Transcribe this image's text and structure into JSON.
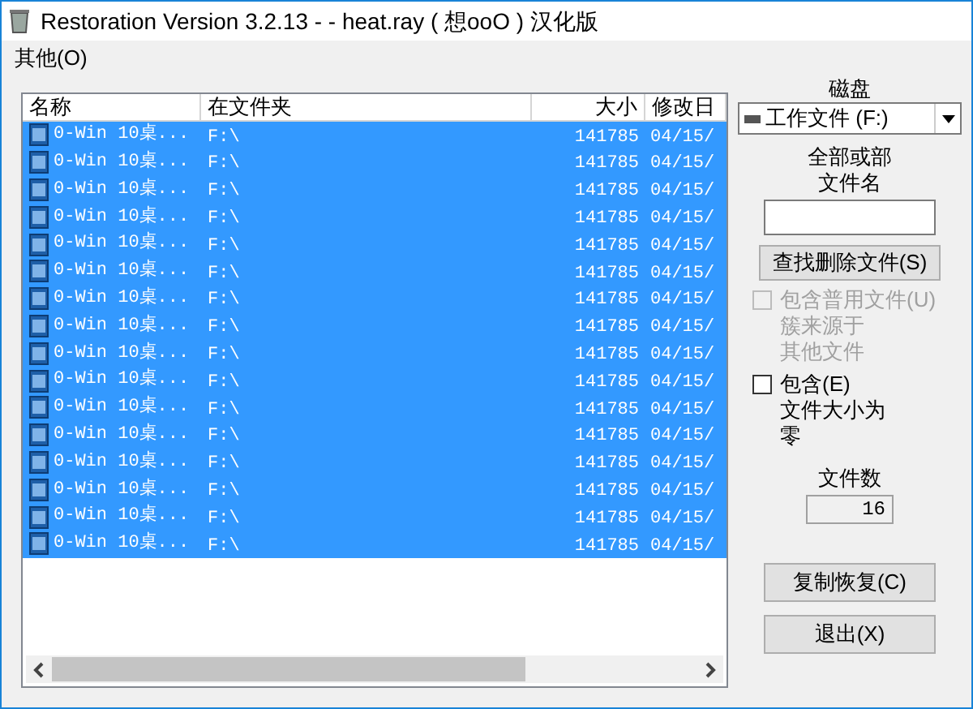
{
  "window": {
    "title": "Restoration Version 3.2.13   - - heat.ray ( 想ooO ) 汉化版"
  },
  "menu": [
    "其他(O)"
  ],
  "table": {
    "columns": [
      "名称",
      "在文件夹",
      "大小",
      "修改日"
    ],
    "rows": [
      {
        "name": "0-Win 10桌...",
        "folder": "F:\\",
        "size": "141785",
        "date": "04/15/",
        "selected": true
      },
      {
        "name": "0-Win 10桌...",
        "folder": "F:\\",
        "size": "141785",
        "date": "04/15/",
        "selected": true
      },
      {
        "name": "0-Win 10桌...",
        "folder": "F:\\",
        "size": "141785",
        "date": "04/15/",
        "selected": true
      },
      {
        "name": "0-Win 10桌...",
        "folder": "F:\\",
        "size": "141785",
        "date": "04/15/",
        "selected": true
      },
      {
        "name": "0-Win 10桌...",
        "folder": "F:\\",
        "size": "141785",
        "date": "04/15/",
        "selected": true
      },
      {
        "name": "0-Win 10桌...",
        "folder": "F:\\",
        "size": "141785",
        "date": "04/15/",
        "selected": true
      },
      {
        "name": "0-Win 10桌...",
        "folder": "F:\\",
        "size": "141785",
        "date": "04/15/",
        "selected": true
      },
      {
        "name": "0-Win 10桌...",
        "folder": "F:\\",
        "size": "141785",
        "date": "04/15/",
        "selected": true
      },
      {
        "name": "0-Win 10桌...",
        "folder": "F:\\",
        "size": "141785",
        "date": "04/15/",
        "selected": true
      },
      {
        "name": "0-Win 10桌...",
        "folder": "F:\\",
        "size": "141785",
        "date": "04/15/",
        "selected": true
      },
      {
        "name": "0-Win 10桌...",
        "folder": "F:\\",
        "size": "141785",
        "date": "04/15/",
        "selected": true
      },
      {
        "name": "0-Win 10桌...",
        "folder": "F:\\",
        "size": "141785",
        "date": "04/15/",
        "selected": true
      },
      {
        "name": "0-Win 10桌...",
        "folder": "F:\\",
        "size": "141785",
        "date": "04/15/",
        "selected": true
      },
      {
        "name": "0-Win 10桌...",
        "folder": "F:\\",
        "size": "141785",
        "date": "04/15/",
        "selected": true
      },
      {
        "name": "0-Win 10桌...",
        "folder": "F:\\",
        "size": "141785",
        "date": "04/15/",
        "selected": true
      },
      {
        "name": "0-Win 10桌...",
        "folder": "F:\\",
        "size": "141785",
        "date": "04/15/",
        "selected": true
      }
    ]
  },
  "panel": {
    "drive_label": "磁盘",
    "drive": "工作文件 (F:)",
    "filename_label": "全部或部文件名",
    "find_button": "查找删除文件(S)",
    "options": [
      {
        "label": "包含普用文件(U)",
        "note": "簇来源于其他文件",
        "checked": false,
        "disabled": true
      },
      {
        "label": "包含(E)",
        "note": "文件大小为零",
        "checked": false,
        "disabled": false
      }
    ],
    "count_label": "文件数",
    "count": "16",
    "restore_button": "复制恢复(C)",
    "exit_button": "退出(X)"
  }
}
